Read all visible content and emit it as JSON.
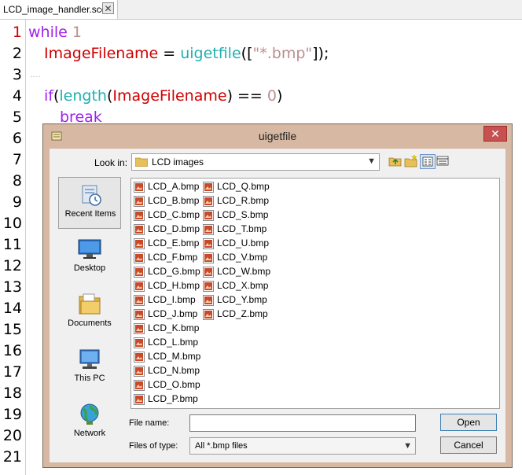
{
  "editor": {
    "tab_title": "LCD_image_handler.sce",
    "tab_close": "✕",
    "line_numbers": [
      "1",
      "2",
      "3",
      "4",
      "5",
      "6",
      "7",
      "8",
      "9",
      "10",
      "11",
      "12",
      "13",
      "14",
      "15",
      "16",
      "17",
      "18",
      "19",
      "20",
      "21"
    ],
    "code": {
      "l1_kw": "while",
      "l1_num": "1",
      "l2_var": "ImageFilename",
      "l2_eq": " = ",
      "l2_fn": "uigetfile",
      "l2_open": "([",
      "l2_str": "\"*.bmp\"",
      "l2_close": "]);",
      "l4_kw": "if",
      "l4_open": "(",
      "l4_fn": "length",
      "l4_paren": "(",
      "l4_var": "ImageFilename",
      "l4_close": ") == ",
      "l4_num": "0",
      "l4_end": ")",
      "l5_kw": "break"
    }
  },
  "dialog": {
    "title": "uigetfile",
    "close_label": "✕",
    "look_in_label": "Look in:",
    "look_in_value": "LCD images",
    "places": [
      "Recent Items",
      "Desktop",
      "Documents",
      "This PC",
      "Network"
    ],
    "files_col1": [
      "LCD_A.bmp",
      "LCD_B.bmp",
      "LCD_C.bmp",
      "LCD_D.bmp",
      "LCD_E.bmp",
      "LCD_F.bmp",
      "LCD_G.bmp",
      "LCD_H.bmp",
      "LCD_I.bmp",
      "LCD_J.bmp",
      "LCD_K.bmp",
      "LCD_L.bmp",
      "LCD_M.bmp",
      "LCD_N.bmp",
      "LCD_O.bmp",
      "LCD_P.bmp"
    ],
    "files_col2": [
      "LCD_Q.bmp",
      "LCD_R.bmp",
      "LCD_S.bmp",
      "LCD_T.bmp",
      "LCD_U.bmp",
      "LCD_V.bmp",
      "LCD_W.bmp",
      "LCD_X.bmp",
      "LCD_Y.bmp",
      "LCD_Z.bmp"
    ],
    "file_name_label": "File name:",
    "file_name_value": "",
    "files_of_type_label": "Files of type:",
    "files_of_type_value": "All *.bmp files",
    "open_button": "Open",
    "cancel_button": "Cancel"
  },
  "icons": {
    "tab_close": "close-icon",
    "dialog_close": "close-icon",
    "folder": "folder-icon",
    "combo": "chevron-down-icon",
    "up_folder": "up-folder-icon",
    "new_folder": "new-folder-icon",
    "view_list": "list-view-icon",
    "view_details": "details-view-icon",
    "file": "bmp-file-icon"
  },
  "colors": {
    "keyword": "#a020f0",
    "number": "#bc8f8f",
    "variable": "#d00000",
    "function": "#20b0b0",
    "dialog_frame": "#d6b8a3",
    "close_button": "#c75050"
  }
}
